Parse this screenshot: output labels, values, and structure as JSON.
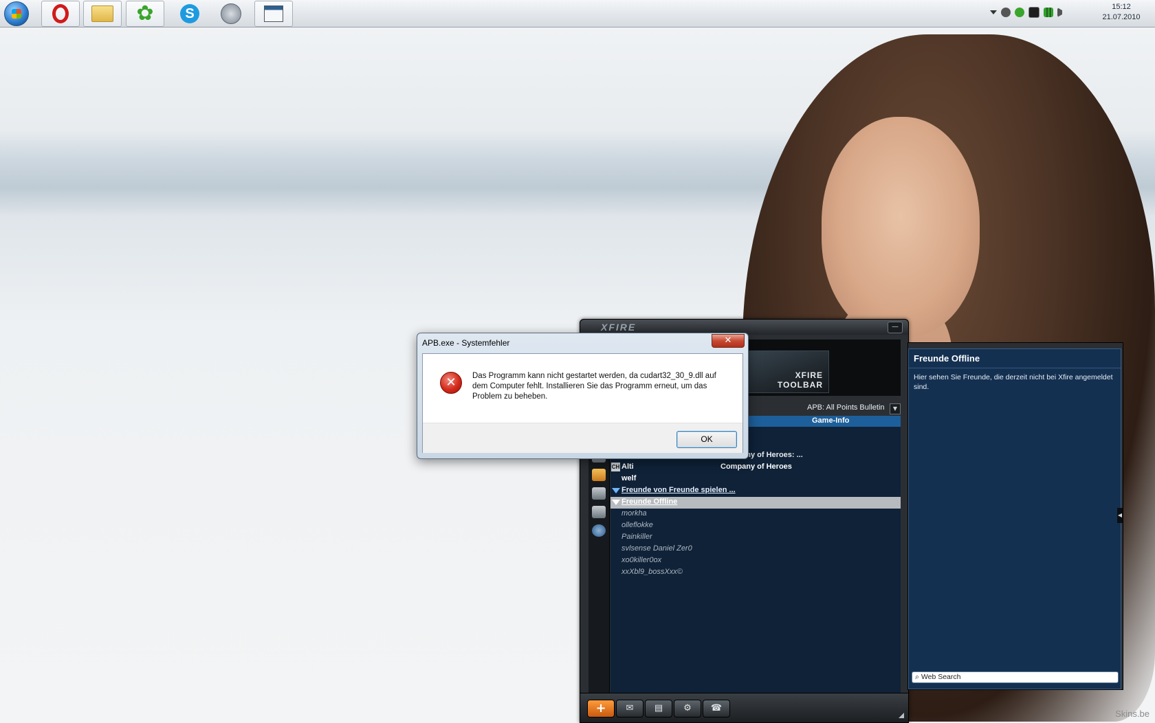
{
  "taskbar": {
    "pinned": [
      {
        "name": "opera",
        "icon": "opera-icon"
      },
      {
        "name": "explorer",
        "icon": "folder-icon"
      },
      {
        "name": "icq",
        "icon": "icq-flower-icon"
      },
      {
        "name": "skype",
        "icon": "skype-icon",
        "letter": "S"
      },
      {
        "name": "teamspeak",
        "icon": "teamspeak-icon"
      },
      {
        "name": "window",
        "icon": "window-icon"
      }
    ],
    "clock": {
      "time": "15:12",
      "date": "21.07.2010"
    }
  },
  "xfire": {
    "logo": "XFIRE",
    "minimize": "—",
    "toolbar_banner": {
      "line1": "XFIRE",
      "line2": "TOOLBAR"
    },
    "game_select": "APB: All Points Bulletin",
    "game_select_arrow": "▼",
    "column_game": "Game-Info",
    "rows": [
      {
        "name": "Alti",
        "game": "Company of Heroes",
        "badge": "CH",
        "kind": "player"
      },
      {
        "name": "welf",
        "game": "",
        "kind": "player"
      },
      {
        "name": "Freunde von Freunde spielen ...",
        "kind": "group"
      },
      {
        "name": "Freunde Offline",
        "kind": "group-selected"
      },
      {
        "name": "morkha",
        "kind": "offline"
      },
      {
        "name": "olleflokke",
        "kind": "offline"
      },
      {
        "name": "Painkiller",
        "kind": "offline"
      },
      {
        "name": "svlsense Daniel Zer0",
        "kind": "offline"
      },
      {
        "name": "xo0killer0ox",
        "kind": "offline"
      },
      {
        "name": "xxXbl9_bossXxx©",
        "kind": "offline"
      }
    ],
    "partial_row_game": "Company of Heroes: ...",
    "bottom_buttons": [
      "+",
      "✉",
      "▤",
      "⚙",
      "☎"
    ]
  },
  "side_panel": {
    "title": "Freunde Offline",
    "description": "Hier sehen Sie Freunde, die derzeit nicht bei Xfire angemeldet sind.",
    "search_label": "Web Search"
  },
  "dialog": {
    "title": "APB.exe - Systemfehler",
    "close": "✕",
    "error_glyph": "✕",
    "message": "Das Programm kann nicht gestartet werden, da cudart32_30_9.dll auf dem Computer fehlt. Installieren Sie das Programm erneut, um das Problem zu beheben.",
    "ok_label": "OK"
  },
  "watermark": "Skins.be"
}
